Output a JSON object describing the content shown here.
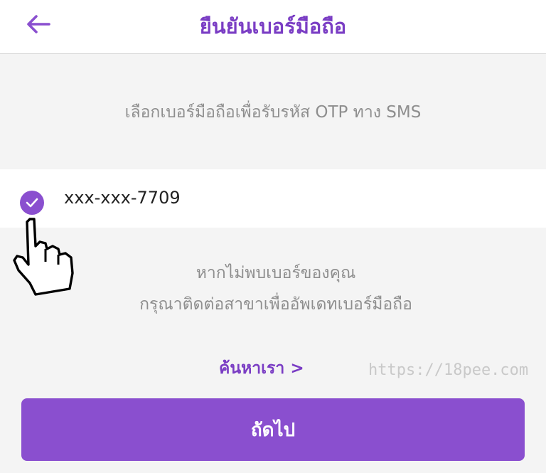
{
  "colors": {
    "accent": "#8a4fcf",
    "title": "#7a3dc4",
    "muted_text": "#8e8e8e",
    "background": "#f4f4f4",
    "button": "#8a4fcf"
  },
  "header": {
    "back_icon": "arrow-left-icon",
    "title": "ยืนยันเบอร์มือถือ"
  },
  "instruction": "เลือกเบอร์มือถือเพื่อรับรหัส OTP ทาง SMS",
  "phone_option": {
    "selected": true,
    "check_icon": "checkmark-circle-icon",
    "number": "xxx-xxx-7709"
  },
  "cursor_icon": "hand-pointer-icon",
  "not_found": {
    "line1": "หากไม่พบเบอร์ของคุณ",
    "line2": "กรุณาติดต่อสาขาเพื่ออัพเดทเบอร์มือถือ"
  },
  "find_us_link": "ค้นหาเรา >",
  "watermark": "https://18pee.com",
  "next_button": "ถัดไป"
}
